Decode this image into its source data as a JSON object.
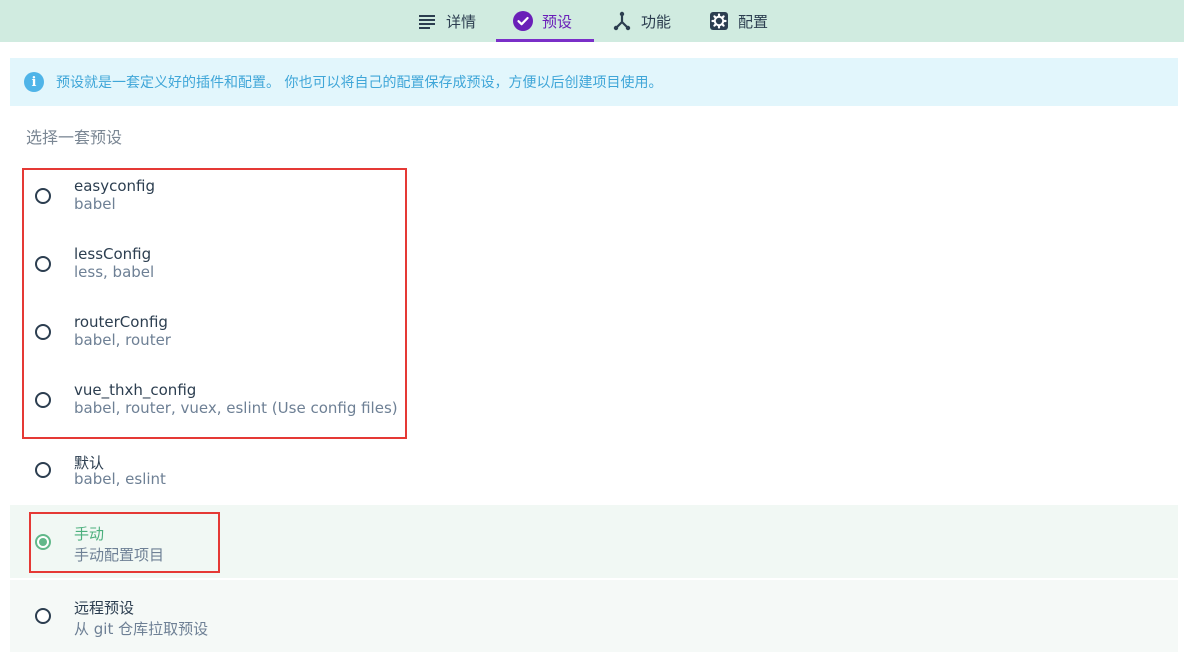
{
  "tabs": [
    {
      "label": "详情",
      "icon": "details-lines-icon",
      "active": false
    },
    {
      "label": "预设",
      "icon": "check-circle-icon",
      "active": true
    },
    {
      "label": "功能",
      "icon": "fork-icon",
      "active": false
    },
    {
      "label": "配置",
      "icon": "gear-icon",
      "active": false
    }
  ],
  "info": {
    "icon": "info-icon",
    "text": "预设就是一套定义好的插件和配置。 你也可以将自己的配置保存成预设，方便以后创建项目使用。"
  },
  "section_title": "选择一套预设",
  "presets": [
    {
      "name": "easyconfig",
      "desc": "babel",
      "selected": false
    },
    {
      "name": "lessConfig",
      "desc": "less, babel",
      "selected": false
    },
    {
      "name": "routerConfig",
      "desc": "babel, router",
      "selected": false
    },
    {
      "name": "vue_thxh_config",
      "desc": "babel, router, vuex, eslint (Use config files)",
      "selected": false
    },
    {
      "name": "默认",
      "desc": "babel, eslint",
      "selected": false
    },
    {
      "name": "手动",
      "desc": "手动配置项目",
      "selected": true
    },
    {
      "name": "远程预设",
      "desc": "从 git 仓库拉取预设",
      "selected": false
    }
  ],
  "colors": {
    "tabbar_bg": "#d0ebe0",
    "active_tab": "#6a1fb8",
    "info_bg": "#e2f6fc",
    "info_text": "#3fa6d8",
    "selected_green": "#4caf7d",
    "annotation_red": "#e53935"
  }
}
